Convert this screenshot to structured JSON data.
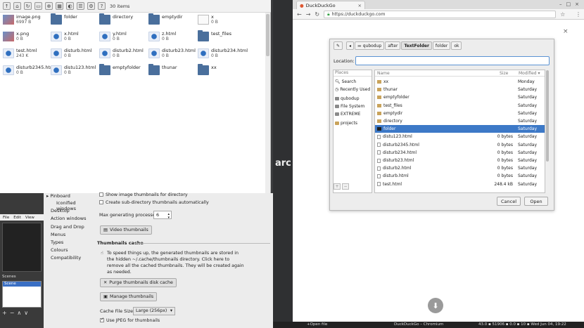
{
  "file_manager": {
    "item_count": "30 items",
    "items": [
      {
        "name": "image.png",
        "size": "6997 B",
        "type": "img"
      },
      {
        "name": "folder",
        "size": "",
        "type": "folder"
      },
      {
        "name": "directory",
        "size": "",
        "type": "folder"
      },
      {
        "name": "emptydir",
        "size": "",
        "type": "folder"
      },
      {
        "name": "x",
        "size": "0 B",
        "type": "doc"
      },
      {
        "name": "x.png",
        "size": "0 B",
        "type": "img"
      },
      {
        "name": "x.html",
        "size": "0 B",
        "type": "html"
      },
      {
        "name": "y.html",
        "size": "0 B",
        "type": "html"
      },
      {
        "name": "z.html",
        "size": "0 B",
        "type": "html"
      },
      {
        "name": "test_files",
        "size": "",
        "type": "folder"
      },
      {
        "name": "test.html",
        "size": "243 K",
        "type": "html"
      },
      {
        "name": "disturb.html",
        "size": "0 B",
        "type": "html"
      },
      {
        "name": "disturb2.html",
        "size": "0 B",
        "type": "html"
      },
      {
        "name": "disturb23.html",
        "size": "0 B",
        "type": "html"
      },
      {
        "name": "disturb234.html",
        "size": "0 B",
        "type": "html"
      },
      {
        "name": "disturb2345.html",
        "size": "0 B",
        "type": "html"
      },
      {
        "name": "distu123.html",
        "size": "0 B",
        "type": "html"
      },
      {
        "name": "emptyfolder",
        "size": "",
        "type": "folder"
      },
      {
        "name": "thunar",
        "size": "",
        "type": "folder"
      },
      {
        "name": "xx",
        "size": "",
        "type": "folder"
      }
    ]
  },
  "obs": {
    "menu": [
      "File",
      "Edit",
      "View"
    ],
    "scenes_label": "Scenes",
    "scene_item": "Scene",
    "controls": [
      "+",
      "−",
      "∧",
      "∨"
    ]
  },
  "settings": {
    "nav": [
      "Pinboard",
      "Iconified windows",
      "Desktop",
      "Action windows",
      "Drag and Drop",
      "Menus",
      "Types",
      "Colours",
      "Compatibility"
    ],
    "show_thumb": "Show image thumbnails for directory",
    "create_sub": "Create sub-directory thumbnails automatically",
    "max_proc_label": "Max generating processes:",
    "max_proc_value": "6",
    "video_thumbs": "Video thumbnails",
    "cache_title": "Thumbnails cache",
    "cache_desc_1": "To speed things up, the generated thumbnails are stored in",
    "cache_desc_2": "the hidden ~/.cache/thumbnails directory. Click here to",
    "cache_desc_3": "remove all the cached thumbnails. They will be created again",
    "cache_desc_4": "as needed.",
    "purge": "Purge thumbnails disk cache",
    "manage": "Manage thumbnails",
    "cache_size_label": "Cache File Size:",
    "cache_size_value": "Large (256px)",
    "use_jpeg": "Use JPEG for thumbnails"
  },
  "center": {
    "text": "arc"
  },
  "browser": {
    "tab_title": "DuckDuckGo",
    "url": "https://duckduckgo.com",
    "dialog": {
      "path": [
        "qubodup",
        "after",
        "TextFolder",
        "folder",
        "ok"
      ],
      "location_label": "Location:",
      "places_header": "Places",
      "places": [
        "Search",
        "Recently Used",
        "qubodup",
        "File System",
        "EXTREME",
        "projects"
      ],
      "col_name": "Name",
      "col_size": "Size",
      "col_modified": "Modified ▾",
      "rows": [
        {
          "name": "xx",
          "size": "",
          "mod": "Monday",
          "kind": "folder"
        },
        {
          "name": "thunar",
          "size": "",
          "mod": "Saturday",
          "kind": "folder"
        },
        {
          "name": "emptyfolder",
          "size": "",
          "mod": "Saturday",
          "kind": "folder"
        },
        {
          "name": "test_files",
          "size": "",
          "mod": "Saturday",
          "kind": "folder"
        },
        {
          "name": "emptydir",
          "size": "",
          "mod": "Saturday",
          "kind": "folder"
        },
        {
          "name": "directory",
          "size": "",
          "mod": "Saturday",
          "kind": "folder"
        },
        {
          "name": "folder",
          "size": "",
          "mod": "Saturday",
          "kind": "folder",
          "selected": true
        },
        {
          "name": "distu123.html",
          "size": "0 bytes",
          "mod": "Saturday",
          "kind": "file"
        },
        {
          "name": "disturb2345.html",
          "size": "0 bytes",
          "mod": "Saturday",
          "kind": "file"
        },
        {
          "name": "disturb234.html",
          "size": "0 bytes",
          "mod": "Saturday",
          "kind": "file"
        },
        {
          "name": "disturb23.html",
          "size": "0 bytes",
          "mod": "Saturday",
          "kind": "file"
        },
        {
          "name": "disturb2.html",
          "size": "0 bytes",
          "mod": "Saturday",
          "kind": "file"
        },
        {
          "name": "disturb.html",
          "size": "0 bytes",
          "mod": "Saturday",
          "kind": "file"
        },
        {
          "name": "test.html",
          "size": "248.4 kB",
          "mod": "Saturday",
          "kind": "file"
        }
      ],
      "cancel": "Cancel",
      "open": "Open"
    }
  },
  "taskbar": {
    "left": "+Open file",
    "chrome": "DuckDuckGo – Chromium",
    "status": "43.0 ▪ 51906 ▪ 0.0 ▪ 10 ▪ Wed Jun 04, 19:22"
  }
}
